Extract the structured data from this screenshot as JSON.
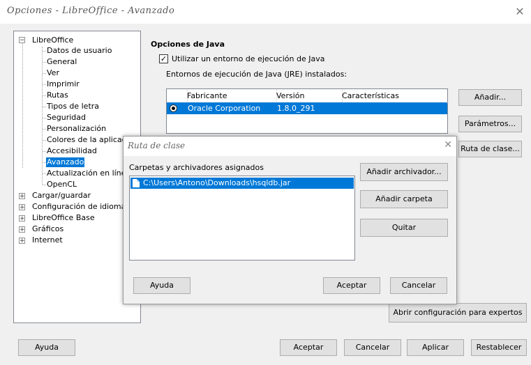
{
  "window": {
    "title": "Opciones - LibreOffice - Avanzado"
  },
  "tree": {
    "root_libreoffice": "LibreOffice",
    "children": [
      "Datos de usuario",
      "General",
      "Ver",
      "Imprimir",
      "Rutas",
      "Tipos de letra",
      "Seguridad",
      "Personalización",
      "Colores de la aplicación",
      "Accesibilidad",
      "Avanzado",
      "Actualización en línea",
      "OpenCL"
    ],
    "roots": [
      "Cargar/guardar",
      "Configuración de idioma",
      "LibreOffice Base",
      "Gráficos",
      "Internet"
    ],
    "selected": "Avanzado"
  },
  "java": {
    "section_title": "Opciones de Java",
    "use_jre_label": "Utilizar un entorno de ejecución de Java",
    "use_jre_checked": true,
    "installed_label": "Entornos de ejecución de Java (JRE) instalados:",
    "columns": [
      "Fabricante",
      "Versión",
      "Características"
    ],
    "rows": [
      {
        "vendor": "Oracle Corporation",
        "version": "1.8.0_291",
        "features": ""
      }
    ],
    "add_button": "Añadir...",
    "parameters_button": "Parámetros...",
    "classpath_button": "Ruta de clase..."
  },
  "expert_button": "Abrir configuración para expertos",
  "footer": {
    "help": "Ayuda",
    "ok": "Aceptar",
    "cancel": "Cancelar",
    "apply": "Aplicar",
    "reset": "Restablecer"
  },
  "classpath_dialog": {
    "title": "Ruta de clase",
    "assigned_label": "Carpetas y archivadores asignados",
    "items": [
      "C:\\Users\\Antono\\Downloads\\hsqldb.jar"
    ],
    "add_archive": "Añadir archivador...",
    "add_folder": "Añadir carpeta",
    "remove": "Quitar",
    "help": "Ayuda",
    "ok": "Aceptar",
    "cancel": "Cancelar"
  }
}
